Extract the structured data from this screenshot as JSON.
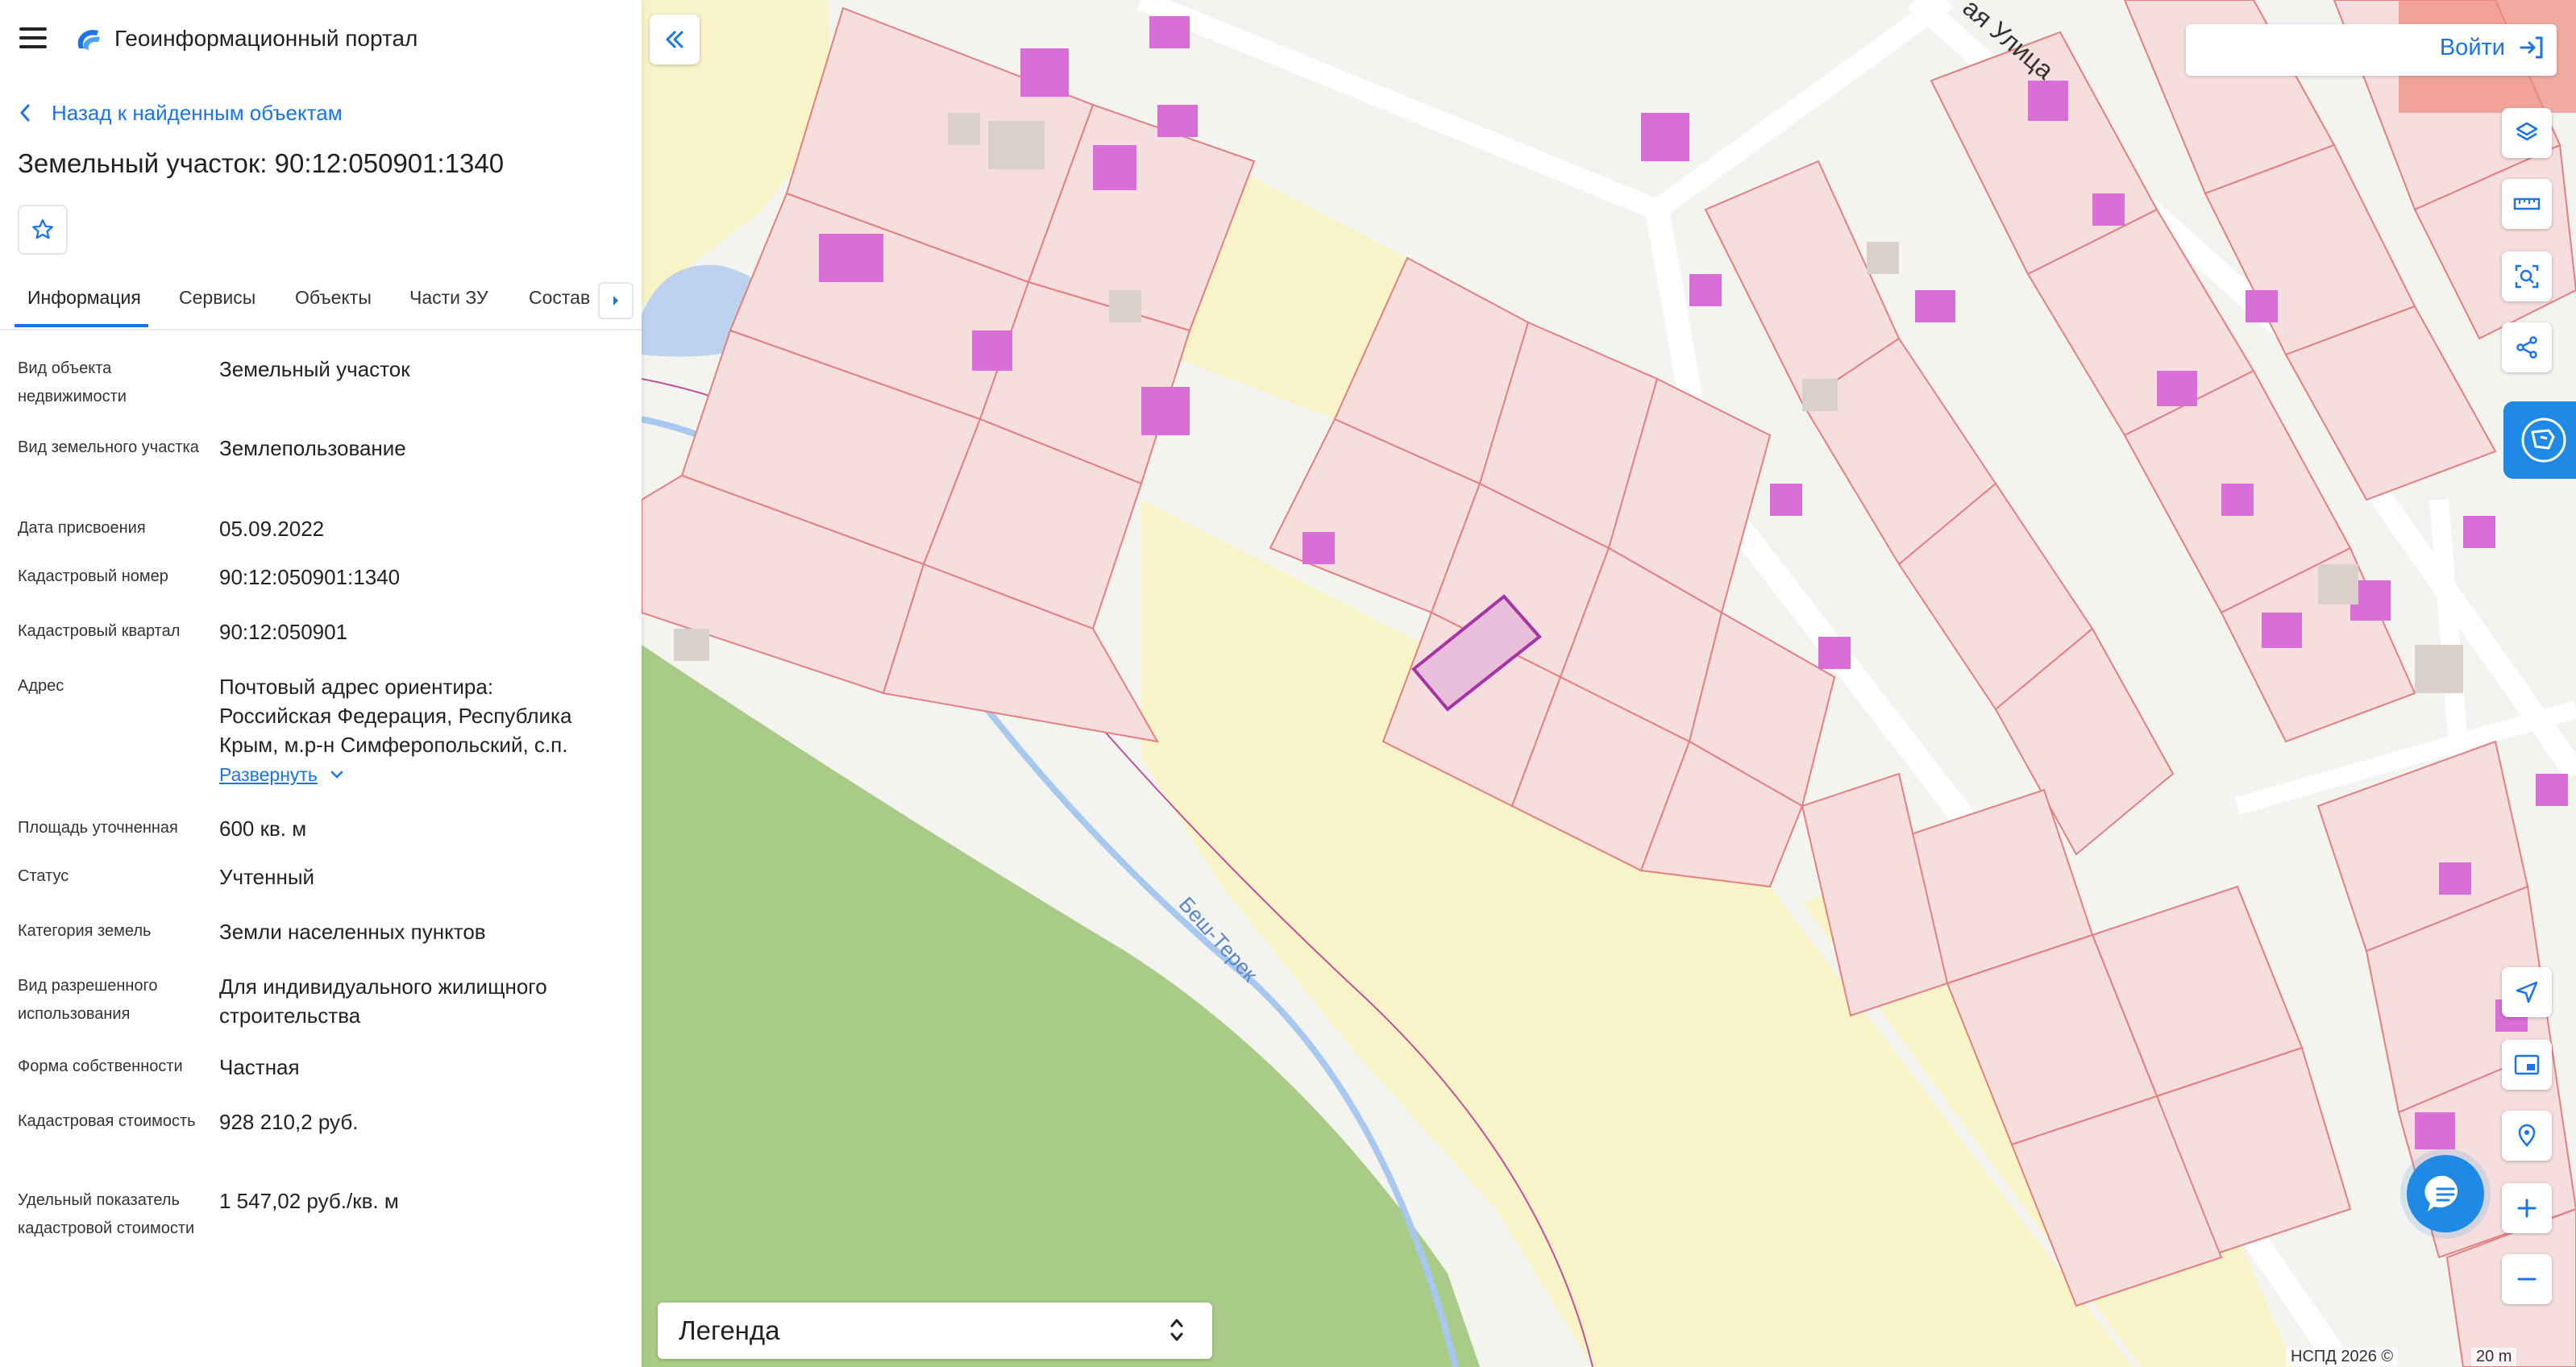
{
  "header": {
    "app_title": "Геоинформационный портал"
  },
  "nav": {
    "back_label": "Назад к найденным объектам"
  },
  "object": {
    "title": "Земельный участок: 90:12:050901:1340"
  },
  "tabs": [
    {
      "label": "Информация",
      "active": true
    },
    {
      "label": "Сервисы"
    },
    {
      "label": "Объекты"
    },
    {
      "label": "Части ЗУ"
    },
    {
      "label": "Состав"
    }
  ],
  "info": {
    "rows": [
      {
        "label": "Вид объекта недвижимости",
        "value": "Земельный участок"
      },
      {
        "label": "Вид земельного участка",
        "value": "Землепользование"
      },
      {
        "label": "Дата присвоения",
        "value": "05.09.2022"
      },
      {
        "label": "Кадастровый номер",
        "value": "90:12:050901:1340"
      },
      {
        "label": "Кадастровый квартал",
        "value": "90:12:050901"
      },
      {
        "label": "Адрес",
        "value": "Почтовый адрес ориентира: Российская Федерация, Республика Крым, м.р-н Симферопольский, с.п."
      },
      {
        "label": "Площадь уточненная",
        "value": "600 кв. м"
      },
      {
        "label": "Статус",
        "value": "Учтенный"
      },
      {
        "label": "Категория земель",
        "value": "Земли населенных пунктов"
      },
      {
        "label": "Вид разрешенного использования",
        "value": "Для индивидуального жилищного строительства"
      },
      {
        "label": "Форма собственности",
        "value": "Частная"
      },
      {
        "label": "Кадастровая стоимость",
        "value": "928 210,2 руб."
      },
      {
        "label": "Удельный показатель кадастровой стоимости",
        "value": "1 547,02 руб./кв. м"
      }
    ],
    "expand_label": "Развернуть"
  },
  "map": {
    "login_label": "Войти",
    "legend_label": "Легенда",
    "street_label": "ая Улица",
    "river_label": "Беш-Терек",
    "copyright": "НСПД 2026 ©",
    "scale_label": "20 m"
  },
  "colors": {
    "accent": "#1a73e8",
    "parcel_fill": "#f6dede",
    "parcel_stroke": "#e47f7f",
    "building": "#d96ed6",
    "vegetation": "#a8cc87",
    "yellow_zone": "#f8f4c8",
    "water": "#a8c8ef"
  },
  "icons": [
    "menu-icon",
    "logo-icon",
    "chevron-left-icon",
    "star-icon",
    "chevron-right-icon",
    "chevron-down-icon",
    "collapse-icon",
    "login-icon",
    "layers-icon",
    "ruler-icon",
    "select-area-icon",
    "share-icon",
    "extension-icon",
    "locate-icon",
    "minimap-icon",
    "pin-icon",
    "plus-icon",
    "minus-icon",
    "chat-icon",
    "sort-arrows-icon"
  ]
}
